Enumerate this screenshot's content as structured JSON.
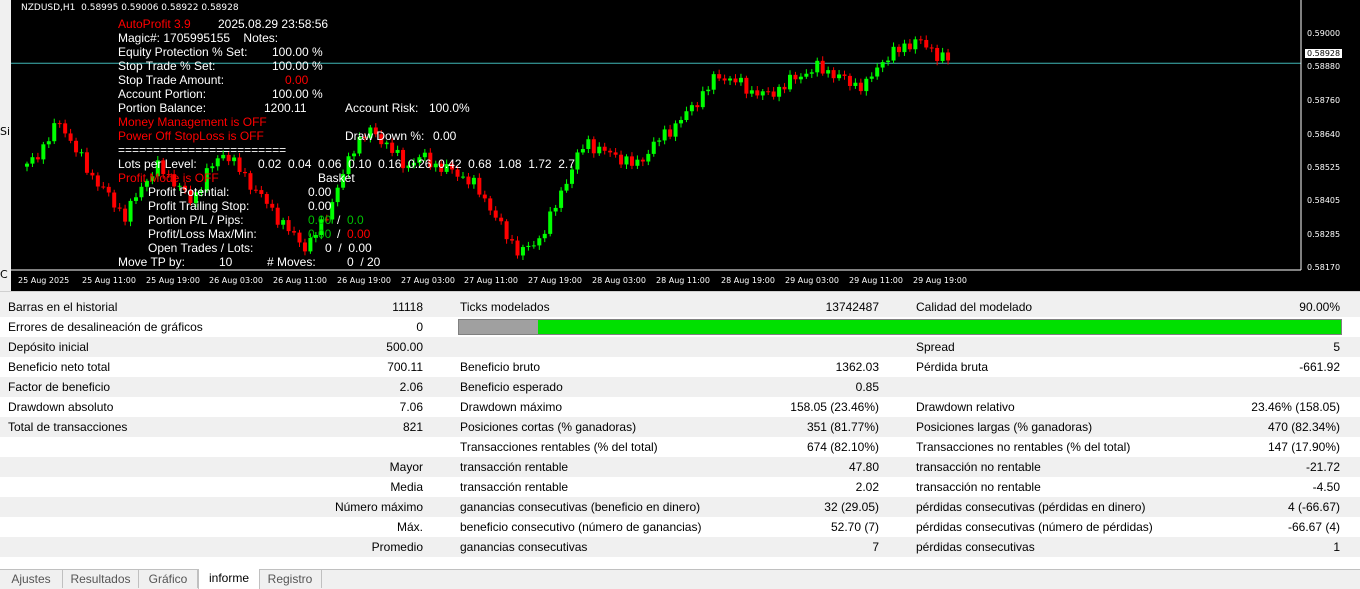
{
  "left_strip": [
    "Si",
    "C"
  ],
  "chart": {
    "symbol_line": "NZDUSD,H1  0.58995 0.59006 0.58922 0.58928",
    "overlay": {
      "ea_name": "AutoProfit 3.9",
      "datetime": "2025.08.29 23:58:56",
      "magic": "Magic#: 1705995155    Notes:",
      "equity_protection_label": "Equity Protection % Set:",
      "equity_protection_value": "100.00 %",
      "stop_trade_pct_label": "Stop Trade % Set:",
      "stop_trade_pct_value": "100.00 %",
      "stop_trade_amount_label": "Stop Trade Amount:",
      "stop_trade_amount_value": "0.00",
      "account_portion_label": "Account Portion:",
      "account_portion_value": "100.00 %",
      "portion_balance_label": "Portion Balance:",
      "portion_balance_value": "1200.11",
      "account_risk_label": "Account Risk:",
      "account_risk_value": "100.0%",
      "money_mgmt": "Money Management is OFF",
      "power_off": "Power Off StopLoss is OFF",
      "draw_down_label": "Draw Down %:",
      "draw_down_value": "0.00",
      "separator": "========================",
      "lots_label": "Lots per Level:",
      "lots_values": "0.02  0.04  0.06  0.10  0.16  0.26  0.42  0.68  1.08  1.72  2.7",
      "profit_mode": "Profit Mode is OFF",
      "basket": "Basket",
      "profit_potential_label": "Profit Potential:",
      "profit_potential_value": "0.00",
      "profit_trailing_label": "Profit Trailing Stop:",
      "profit_trailing_value": "0.00",
      "portion_pl_label": "Portion P/L / Pips:",
      "portion_pl_value1": "0.00",
      "portion_pl_slash": "/",
      "portion_pl_value2": "0.0",
      "profit_loss_label": "Profit/Loss Max/Min:",
      "profit_loss_value1": "0.00",
      "profit_loss_slash": "/",
      "profit_loss_value2": "0.00",
      "open_trades_label": "Open Trades / Lots:",
      "open_trades_value": "0  /  0.00",
      "move_tp_label": "Move TP by:",
      "move_tp_value": "10",
      "moves_label": "# Moves:",
      "moves_value": "0  / 20"
    },
    "y_ticks": [
      "0.59000",
      "0.58880",
      "0.58760",
      "0.58640",
      "0.58525",
      "0.58405",
      "0.58285",
      "0.58170"
    ],
    "current_price": "0.58928",
    "x_ticks": [
      "25 Aug 2025",
      "25 Aug 11:00",
      "25 Aug 19:00",
      "26 Aug 03:00",
      "26 Aug 11:00",
      "26 Aug 19:00",
      "27 Aug 03:00",
      "27 Aug 11:00",
      "27 Aug 19:00",
      "28 Aug 03:00",
      "28 Aug 11:00",
      "28 Aug 19:00",
      "29 Aug 03:00",
      "29 Aug 11:00",
      "29 Aug 19:00"
    ],
    "colors": {
      "bull": "#00ff00",
      "bear": "#ff0000",
      "bg": "#000000",
      "price_line": "#3fb6b6"
    }
  },
  "report": {
    "rows": [
      [
        "Barras en el historial",
        "11118",
        "Ticks modelados",
        "13742487",
        "Calidad del modelado",
        "90.00%"
      ],
      [
        "Errores de desalineación de gráficos",
        "0",
        "",
        "",
        "",
        ""
      ],
      [
        "Depósito inicial",
        "500.00",
        "",
        "",
        "Spread",
        "5"
      ],
      [
        "Beneficio neto total",
        "700.11",
        "Beneficio bruto",
        "1362.03",
        "Pérdida bruta",
        "-661.92"
      ],
      [
        "Factor de beneficio",
        "2.06",
        "Beneficio esperado",
        "0.85",
        "",
        ""
      ],
      [
        "Drawdown absoluto",
        "7.06",
        "Drawdown máximo",
        "158.05 (23.46%)",
        "Drawdown relativo",
        "23.46% (158.05)"
      ],
      [
        "Total de transacciones",
        "821",
        "Posiciones cortas (% ganadoras)",
        "351 (81.77%)",
        "Posiciones largas (% ganadoras)",
        "470 (82.34%)"
      ],
      [
        "",
        "",
        "Transacciones rentables (% del total)",
        "674 (82.10%)",
        "Transacciones no rentables (% del total)",
        "147 (17.90%)"
      ],
      [
        "",
        "Mayor",
        "transacción rentable",
        "47.80",
        "transacción no rentable",
        "-21.72"
      ],
      [
        "",
        "Media",
        "transacción rentable",
        "2.02",
        "transacción no rentable",
        "-4.50"
      ],
      [
        "",
        "Número máximo",
        "ganancias consecutivas (beneficio en dinero)",
        "32 (29.05)",
        "pérdidas consecutivas (pérdidas en dinero)",
        "4 (-66.67)"
      ],
      [
        "",
        "Máx.",
        "beneficio consecutivo (número de ganancias)",
        "52.70 (7)",
        "pérdidas consecutivas (número de pérdidas)",
        "-66.67 (4)"
      ],
      [
        "",
        "Promedio",
        "ganancias consecutivas",
        "7",
        "pérdidas consecutivas",
        "1"
      ]
    ],
    "modeling_quality_fraction": 0.9
  },
  "tabs": [
    {
      "label": "Ajustes",
      "active": false
    },
    {
      "label": "Resultados",
      "active": false
    },
    {
      "label": "Gráfico",
      "active": false
    },
    {
      "label": "informe",
      "active": true
    },
    {
      "label": "Registro",
      "active": false
    }
  ]
}
